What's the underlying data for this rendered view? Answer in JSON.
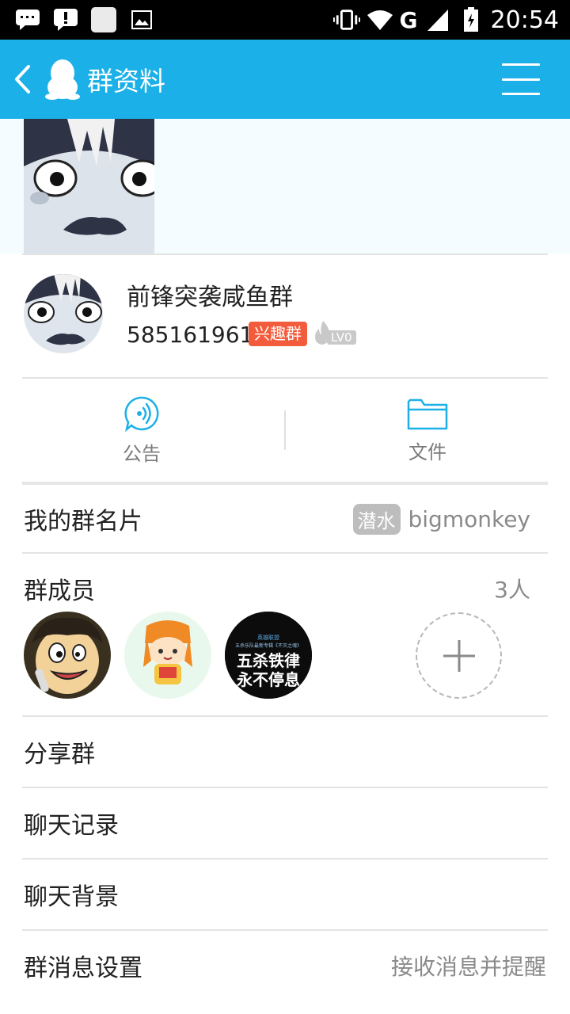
{
  "status_bar": {
    "time": "20:54",
    "network": "G",
    "icons": [
      "message-icon",
      "alert-icon",
      "app-icon",
      "image-icon",
      "vibrate-icon",
      "wifi-icon",
      "signal-icon",
      "battery-icon"
    ]
  },
  "header": {
    "title": "群资料",
    "back_icon": "chevron-left-icon",
    "logo_icon": "qq-penguin-icon",
    "menu_icon": "menu-icon",
    "background": "#1cb0e8"
  },
  "group": {
    "name": "前锋突袭咸鱼群",
    "id": "585161961",
    "type_badge": "兴趣群",
    "level": "LV0"
  },
  "actions": [
    {
      "label": "公告",
      "icon": "announcement-icon"
    },
    {
      "label": "文件",
      "icon": "folder-icon"
    }
  ],
  "rows": {
    "card": {
      "label": "我的群名片",
      "chip": "潜水",
      "value": "bigmonkey"
    },
    "members": {
      "label": "群成员",
      "count": "3人"
    },
    "share": {
      "label": "分享群"
    },
    "history": {
      "label": "聊天记录"
    },
    "background": {
      "label": "聊天背景"
    },
    "notify": {
      "label": "群消息设置",
      "value": "接收消息并提醒"
    }
  },
  "member_avatar3": {
    "line1": "英雄联盟",
    "line2": "五杀乐队最新专辑《不灭之魂》",
    "line3": "五杀铁律",
    "line4": "永不停息"
  },
  "colors": {
    "accent": "#1cb0e8",
    "badge": "#f25b3b"
  }
}
